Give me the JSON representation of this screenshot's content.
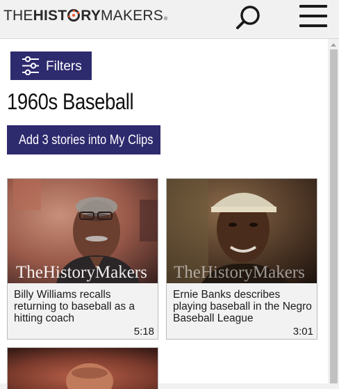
{
  "header": {
    "logo": {
      "the": "THE",
      "hist": "HIST",
      "ry": "RY",
      "makers": "MAKERS",
      "reg": "®"
    }
  },
  "filters": {
    "label": "Filters"
  },
  "page": {
    "title": "1960s Baseball",
    "add_button_label": "Add 3 stories into My Clips"
  },
  "stories": [
    {
      "caption": "Billy Williams recalls returning to baseball as a hitting coach",
      "duration": "5:18",
      "watermark": "TheHistoryMakers"
    },
    {
      "caption": "Ernie Banks describes playing baseball in the Negro Baseball League",
      "duration": "3:01",
      "watermark": "TheHistoryMakers"
    },
    {
      "caption": "",
      "duration": ""
    }
  ],
  "colors": {
    "brand_navy": "#2e2a6e",
    "logo_accent": "#e8542a"
  },
  "icons": {
    "search": "search-icon",
    "menu": "hamburger-menu-icon",
    "filters": "sliders-icon"
  }
}
